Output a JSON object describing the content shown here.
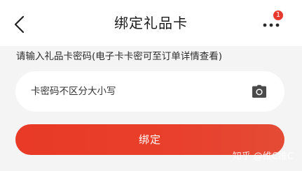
{
  "header": {
    "title": "绑定礼品卡",
    "back_icon": "chevron-left-icon",
    "more_icon": "more-dots-icon",
    "badge_count": "1",
    "badge_color": "#e63a2d"
  },
  "hint": {
    "text": "请输入礼品卡密码(电子卡卡密可至订单详情查看)"
  },
  "card_input": {
    "placeholder": "卡密码不区分大小写",
    "camera_icon": "camera-icon"
  },
  "bind_button": {
    "label": "绑定",
    "color": "#e83a26"
  },
  "watermark": {
    "text": "知乎 @维C维C"
  }
}
